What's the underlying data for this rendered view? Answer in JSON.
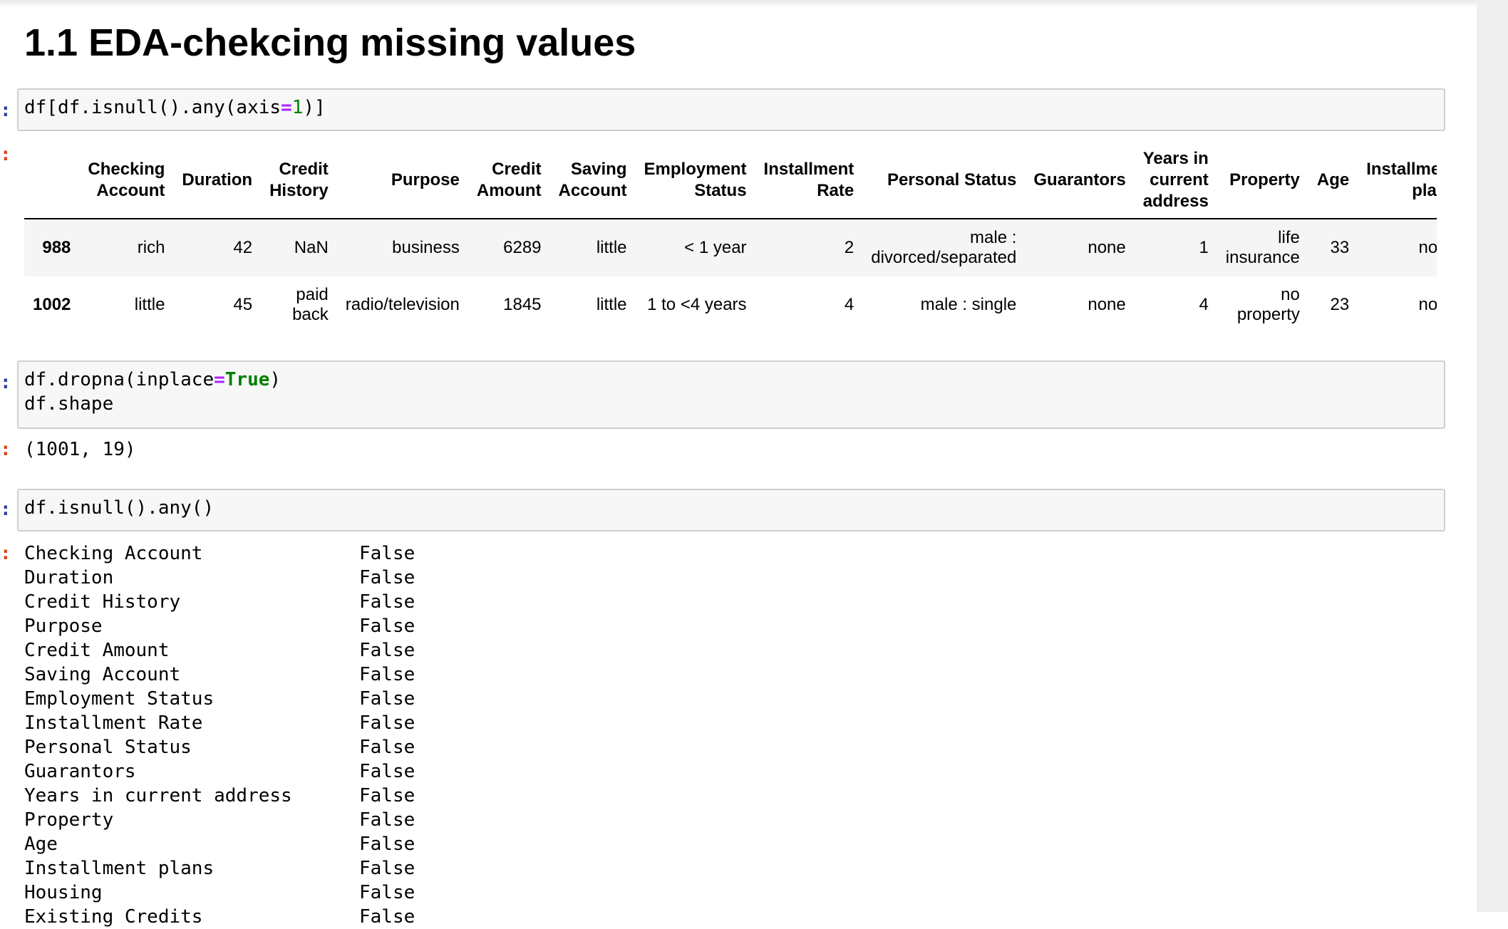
{
  "heading": "1.1 EDA-chekcing missing values",
  "prompt_char": ":",
  "cells": {
    "c1_code": {
      "p1": "df[df.isnull().any(axis",
      "op": "=",
      "num": "1",
      "p2": ")]"
    },
    "c2_code": {
      "l1a": "df.dropna(inplace",
      "op": "=",
      "kw": "True",
      "l1b": ")",
      "l2": "df.shape"
    },
    "c2_output": "(1001, 19)",
    "c3_code": "df.isnull().any()"
  },
  "table": {
    "columns": [
      "",
      "Checking Account",
      "Duration",
      "Credit History",
      "Purpose",
      "Credit Amount",
      "Saving Account",
      "Employment Status",
      "Installment Rate",
      "Personal Status",
      "Guarantors",
      "Years in current address",
      "Property",
      "Age",
      "Installment plans"
    ],
    "rows": [
      [
        "988",
        "rich",
        "42",
        "NaN",
        "business",
        "6289",
        "little",
        "< 1 year",
        "2",
        "male : divorced/separated",
        "none",
        "1",
        "life insurance",
        "33",
        "none"
      ],
      [
        "1002",
        "little",
        "45",
        "paid back",
        "radio/television",
        "1845",
        "little",
        "1 to <4 years",
        "4",
        "male : single",
        "none",
        "4",
        "no property",
        "23",
        "none"
      ]
    ]
  },
  "series": [
    {
      "name": "Checking Account",
      "value": "False"
    },
    {
      "name": "Duration",
      "value": "False"
    },
    {
      "name": "Credit History",
      "value": "False"
    },
    {
      "name": "Purpose",
      "value": "False"
    },
    {
      "name": "Credit Amount",
      "value": "False"
    },
    {
      "name": "Saving Account",
      "value": "False"
    },
    {
      "name": "Employment Status",
      "value": "False"
    },
    {
      "name": "Installment Rate",
      "value": "False"
    },
    {
      "name": "Personal Status",
      "value": "False"
    },
    {
      "name": "Guarantors",
      "value": "False"
    },
    {
      "name": "Years in current address",
      "value": "False"
    },
    {
      "name": "Property",
      "value": "False"
    },
    {
      "name": "Age",
      "value": "False"
    },
    {
      "name": "Installment plans",
      "value": "False"
    },
    {
      "name": "Housing",
      "value": "False"
    },
    {
      "name": "Existing Credits",
      "value": "False"
    }
  ],
  "colors": {
    "input_prompt": "#303f9f",
    "output_prompt": "#d84315",
    "operator": "#aa22ff",
    "literal": "#008000"
  }
}
